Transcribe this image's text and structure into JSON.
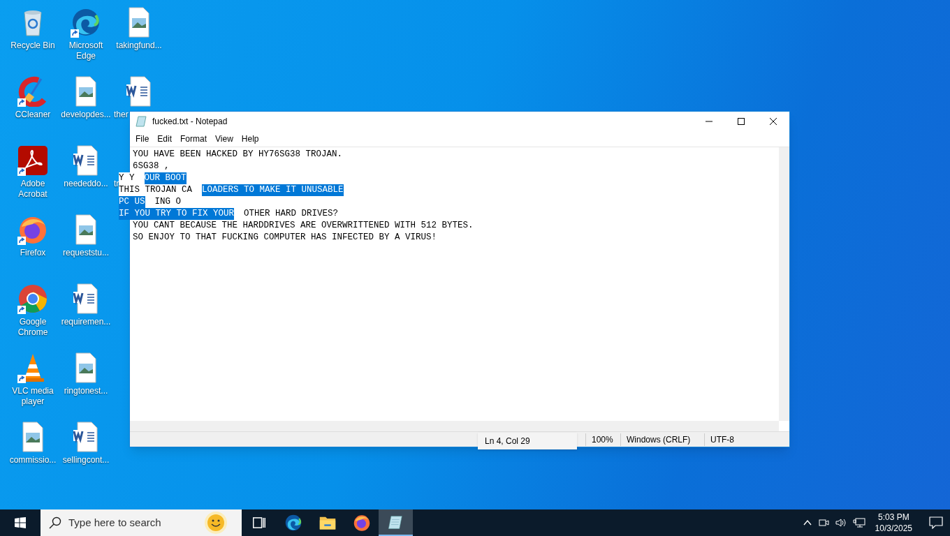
{
  "desktop_icons": [
    [
      {
        "label": "Recycle Bin",
        "kind": "bin",
        "shortcut": false
      },
      {
        "label": "CCleaner",
        "kind": "broom",
        "shortcut": true
      },
      {
        "label": "Adobe Acrobat",
        "kind": "pdf",
        "shortcut": true
      },
      {
        "label": "Firefox",
        "kind": "firefox",
        "shortcut": true
      },
      {
        "label": "Google Chrome",
        "kind": "chrome",
        "shortcut": true
      },
      {
        "label": "VLC media player",
        "kind": "cone",
        "shortcut": true
      },
      {
        "label": "commissio...",
        "kind": "image",
        "shortcut": false
      }
    ],
    [
      {
        "label": "Microsoft Edge",
        "kind": "edge",
        "shortcut": true
      },
      {
        "label": "developdes...",
        "kind": "image",
        "shortcut": false
      },
      {
        "label": "neededdo...",
        "kind": "word",
        "shortcut": false
      },
      {
        "label": "requeststu...",
        "kind": "image",
        "shortcut": false
      },
      {
        "label": "requiremen...",
        "kind": "word",
        "shortcut": false
      },
      {
        "label": "ringtonest...",
        "kind": "image",
        "shortcut": false
      },
      {
        "label": "sellingcont...",
        "kind": "word",
        "shortcut": false
      }
    ],
    [
      {
        "label": "takingfund...",
        "kind": "image",
        "shortcut": false,
        "cut": false
      },
      {
        "label": "ther",
        "kind": "word",
        "shortcut": false,
        "cut": true
      },
      {
        "label": "tr",
        "kind": "none",
        "shortcut": false,
        "cut": true
      }
    ]
  ],
  "notepad": {
    "title": "fucked.txt - Notepad",
    "menu": [
      "File",
      "Edit",
      "Format",
      "View",
      "Help"
    ],
    "lines": [
      [
        {
          "text": "YOU HAVE BEEN HACKED BY HY76SG38 TROJAN.",
          "selected": false
        }
      ],
      [
        {
          "text": "6SG38 ,",
          "selected": false
        }
      ]
    ],
    "glitch_lines": [
      [
        {
          "text": "Y Y",
          "selected": false
        },
        {
          "text": "OUR BOOT",
          "selected": true
        }
      ],
      [
        {
          "text": "THIS TROJAN CA",
          "selected": false
        },
        {
          "text": "LOADERS TO MAKE IT UNUSABLE",
          "selected": true
        }
      ],
      [
        {
          "text": "PC US",
          "selected": true
        },
        {
          "text": "ING O",
          "selected": false
        }
      ],
      [
        {
          "text": "IF YOU TRY TO FIX YOUR",
          "selected": true
        },
        {
          "text": "OTHER HARD DRIVES?",
          "selected": false
        }
      ]
    ],
    "after_lines": [
      [
        {
          "text": "YOU CANT BECAUSE THE HARDDRIVES ARE OVERWRITTENED WITH 512 BYTES.",
          "selected": false
        }
      ],
      [
        {
          "text": "SO ENJOY TO THAT FUCKING COMPUTER HAS INFECTED BY A VIRUS!",
          "selected": false
        }
      ]
    ],
    "status": {
      "position": "Ln 4, Col 29",
      "zoom": "100%",
      "line_ending": "Windows (CRLF)",
      "encoding": "UTF-8"
    }
  },
  "taskbar": {
    "search_placeholder": "Type here to search",
    "apps": [
      {
        "kind": "taskview",
        "selected": false
      },
      {
        "kind": "edge",
        "selected": false
      },
      {
        "kind": "folder",
        "selected": false
      },
      {
        "kind": "firefox",
        "selected": false
      },
      {
        "kind": "notepad",
        "selected": true
      }
    ],
    "time": "5:03 PM",
    "date": "10/3/2025"
  }
}
